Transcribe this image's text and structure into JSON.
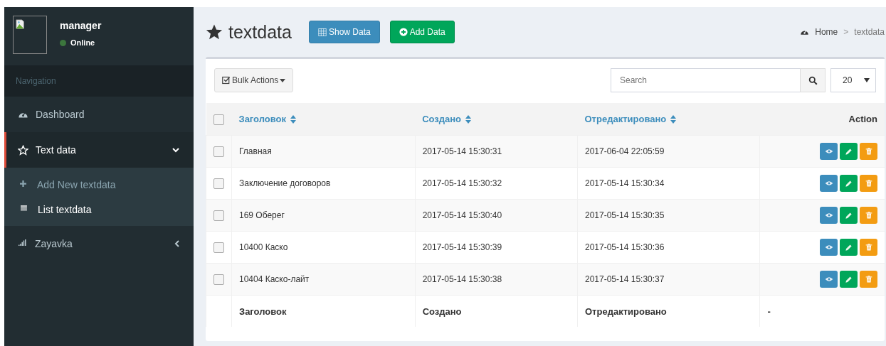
{
  "user": {
    "name": "manager",
    "status": "Online"
  },
  "sidebar": {
    "header": "Navigation",
    "items": [
      {
        "label": "Dashboard",
        "selected": false
      },
      {
        "label": "Text data",
        "selected": true,
        "expanded": true,
        "children": [
          {
            "label": "Add New textdata",
            "selected": false
          },
          {
            "label": "List textdata",
            "selected": true
          }
        ]
      },
      {
        "label": "Zayavka",
        "selected": false,
        "expanded": false
      }
    ]
  },
  "page": {
    "title": "textdata",
    "buttons": [
      {
        "label": "Show Data",
        "kind": "show"
      },
      {
        "label": "Add Data",
        "kind": "add"
      }
    ],
    "breadcrumb": [
      "Home",
      ">",
      "textdata"
    ]
  },
  "toolbar": {
    "bulk": "Bulk Actions",
    "search": {
      "placeholder": "Search"
    },
    "per_page": "20"
  },
  "table": {
    "columns": [
      "Заголовок",
      "Создано",
      "Отредактировано",
      "Action"
    ],
    "rows": [
      {
        "checked": false,
        "cells": [
          "Главная",
          "2017-05-14 15:30:31",
          "2017-06-04 22:05:59"
        ]
      },
      {
        "checked": false,
        "cells": [
          "Заключение договоров",
          "2017-05-14 15:30:32",
          "2017-05-14 15:30:34"
        ]
      },
      {
        "checked": false,
        "cells": [
          "169 Оберег",
          "2017-05-14 15:30:40",
          "2017-05-14 15:30:35"
        ]
      },
      {
        "checked": false,
        "cells": [
          "10400 Каско",
          "2017-05-14 15:30:39",
          "2017-05-14 15:30:36"
        ]
      },
      {
        "checked": false,
        "cells": [
          "10404 Каско-лайт",
          "2017-05-14 15:30:38",
          "2017-05-14 15:30:37"
        ]
      }
    ],
    "footer": [
      "Заголовок",
      "Создано",
      "Отредактировано",
      "-"
    ],
    "all_checked": false
  }
}
